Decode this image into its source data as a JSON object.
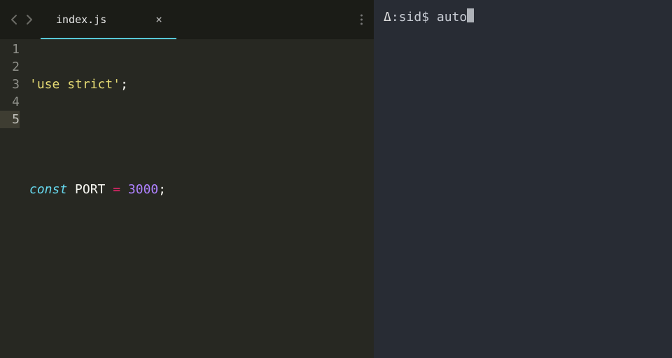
{
  "editor": {
    "tab": {
      "filename": "index.js",
      "close_glyph": "×"
    },
    "lines": [
      "1",
      "2",
      "3",
      "4",
      "5"
    ],
    "current_line_index": 4,
    "code": {
      "line1": {
        "string_open": "'",
        "string_text": "use strict",
        "string_close": "'",
        "semicolon": ";"
      },
      "line3": {
        "keyword": "const",
        "space1": " ",
        "ident": "PORT",
        "space2": " ",
        "op": "=",
        "space3": " ",
        "number": "3000",
        "semicolon": ";"
      }
    }
  },
  "terminal": {
    "prompt_symbol": "Δ",
    "prompt_path": ":sid$",
    "space": " ",
    "input_text": "auto"
  }
}
